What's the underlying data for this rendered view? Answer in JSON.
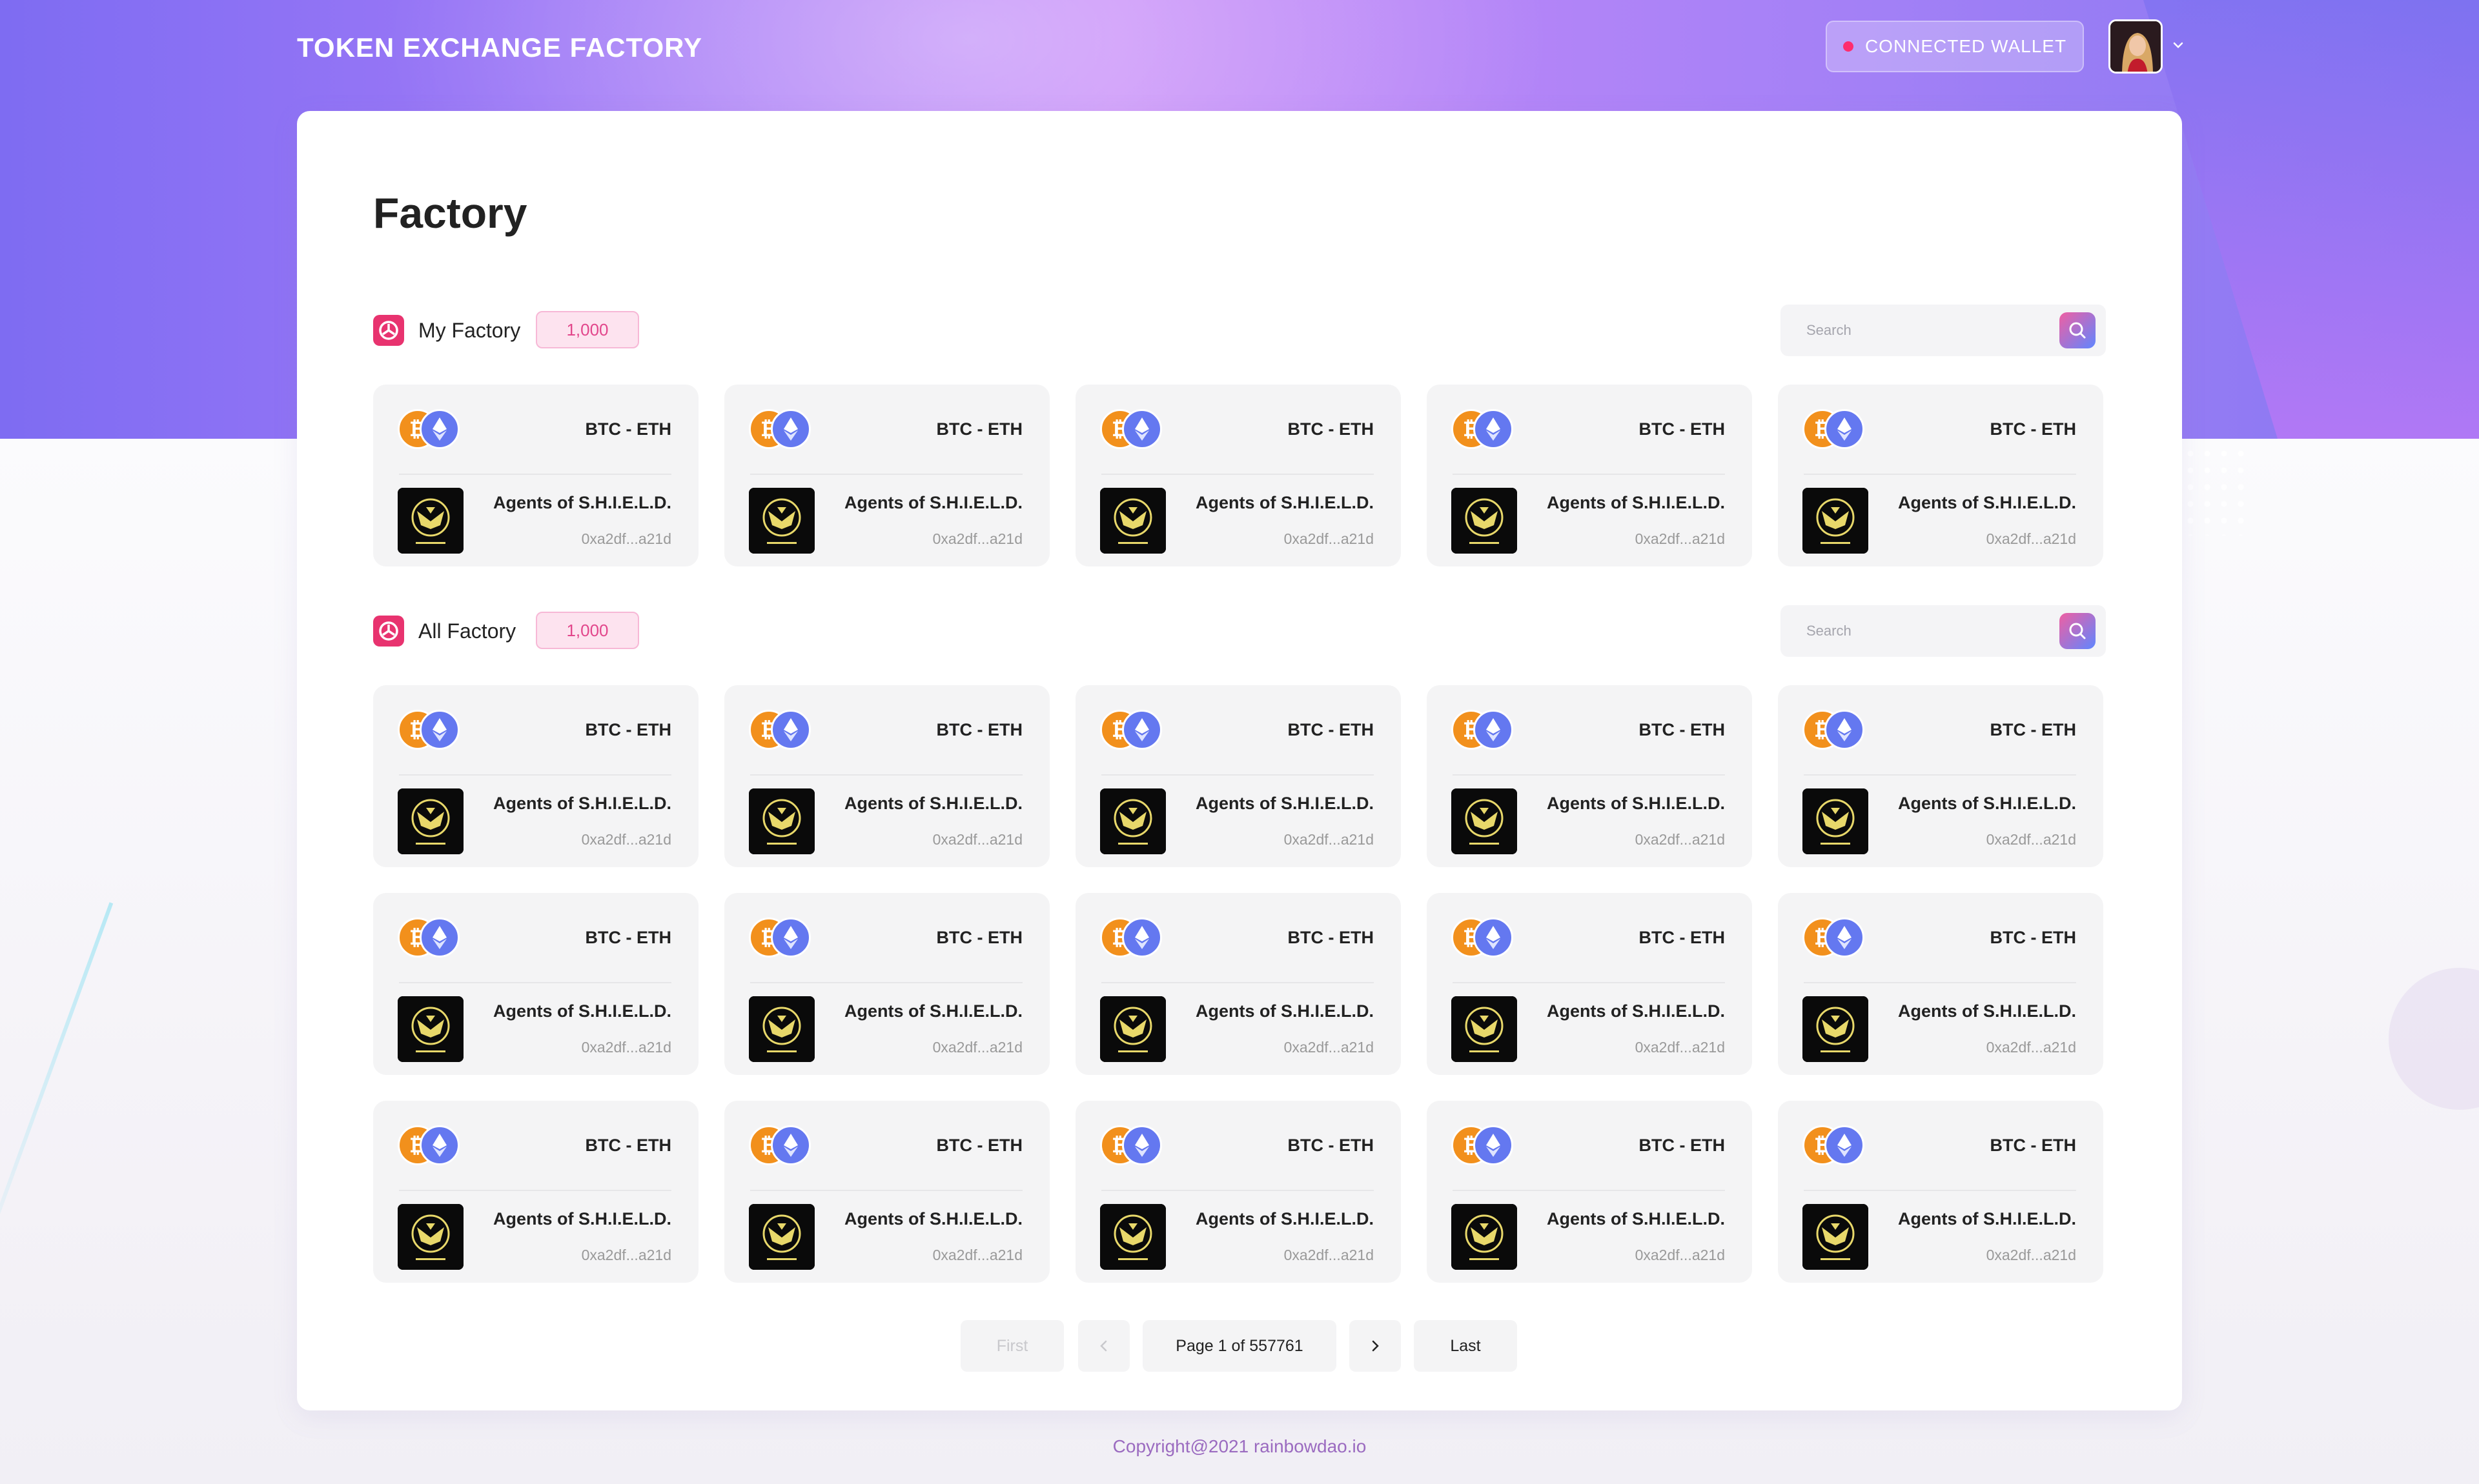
{
  "header": {
    "brand": "TOKEN EXCHANGE FACTORY",
    "wallet_label": "CONNECTED  WALLET",
    "avatar_alt": "user avatar"
  },
  "page": {
    "title": "Factory"
  },
  "my_factory": {
    "label": "My Factory",
    "count": "1,000",
    "search_placeholder": "Search",
    "tiles": [
      {
        "pair": "BTC - ETH",
        "name": "Agents of S.H.I.E.L.D.",
        "address": "0xa2df...a21d"
      },
      {
        "pair": "BTC - ETH",
        "name": "Agents of S.H.I.E.L.D.",
        "address": "0xa2df...a21d"
      },
      {
        "pair": "BTC - ETH",
        "name": "Agents of S.H.I.E.L.D.",
        "address": "0xa2df...a21d"
      },
      {
        "pair": "BTC - ETH",
        "name": "Agents of S.H.I.E.L.D.",
        "address": "0xa2df...a21d"
      },
      {
        "pair": "BTC - ETH",
        "name": "Agents of S.H.I.E.L.D.",
        "address": "0xa2df...a21d"
      }
    ]
  },
  "all_factory": {
    "label": "All Factory",
    "count": "1,000",
    "search_placeholder": "Search",
    "tiles": [
      {
        "pair": "BTC - ETH",
        "name": "Agents of S.H.I.E.L.D.",
        "address": "0xa2df...a21d"
      },
      {
        "pair": "BTC - ETH",
        "name": "Agents of S.H.I.E.L.D.",
        "address": "0xa2df...a21d"
      },
      {
        "pair": "BTC - ETH",
        "name": "Agents of S.H.I.E.L.D.",
        "address": "0xa2df...a21d"
      },
      {
        "pair": "BTC - ETH",
        "name": "Agents of S.H.I.E.L.D.",
        "address": "0xa2df...a21d"
      },
      {
        "pair": "BTC - ETH",
        "name": "Agents of S.H.I.E.L.D.",
        "address": "0xa2df...a21d"
      },
      {
        "pair": "BTC - ETH",
        "name": "Agents of S.H.I.E.L.D.",
        "address": "0xa2df...a21d"
      },
      {
        "pair": "BTC - ETH",
        "name": "Agents of S.H.I.E.L.D.",
        "address": "0xa2df...a21d"
      },
      {
        "pair": "BTC - ETH",
        "name": "Agents of S.H.I.E.L.D.",
        "address": "0xa2df...a21d"
      },
      {
        "pair": "BTC - ETH",
        "name": "Agents of S.H.I.E.L.D.",
        "address": "0xa2df...a21d"
      },
      {
        "pair": "BTC - ETH",
        "name": "Agents of S.H.I.E.L.D.",
        "address": "0xa2df...a21d"
      },
      {
        "pair": "BTC - ETH",
        "name": "Agents of S.H.I.E.L.D.",
        "address": "0xa2df...a21d"
      },
      {
        "pair": "BTC - ETH",
        "name": "Agents of S.H.I.E.L.D.",
        "address": "0xa2df...a21d"
      },
      {
        "pair": "BTC - ETH",
        "name": "Agents of S.H.I.E.L.D.",
        "address": "0xa2df...a21d"
      },
      {
        "pair": "BTC - ETH",
        "name": "Agents of S.H.I.E.L.D.",
        "address": "0xa2df...a21d"
      },
      {
        "pair": "BTC - ETH",
        "name": "Agents of S.H.I.E.L.D.",
        "address": "0xa2df...a21d"
      }
    ]
  },
  "pagination": {
    "first": "First",
    "page_info": "Page 1 of 557761",
    "last": "Last",
    "prev_icon": "chevron-left-icon",
    "next_icon": "chevron-right-icon"
  },
  "footer": {
    "copyright": "Copyright@2021 rainbowdao.io"
  },
  "colors": {
    "accent": "#e8336f",
    "btc": "#f2901c",
    "eth": "#6478f0",
    "badge_text": "#e2468b",
    "footer_text": "#9b6bc0"
  }
}
